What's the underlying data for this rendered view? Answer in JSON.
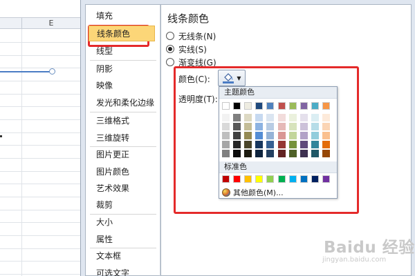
{
  "sheet": {
    "column_header": "E"
  },
  "nav": {
    "items": [
      {
        "label": "填充",
        "selected": false
      },
      {
        "label": "线条颜色",
        "selected": true
      },
      {
        "label": "线型",
        "selected": false
      },
      {
        "label": "阴影",
        "selected": false
      },
      {
        "label": "映像",
        "selected": false
      },
      {
        "label": "发光和柔化边缘",
        "selected": false
      },
      {
        "label": "三维格式",
        "selected": false
      },
      {
        "label": "三维旋转",
        "selected": false
      },
      {
        "label": "图片更正",
        "selected": false
      },
      {
        "label": "图片颜色",
        "selected": false
      },
      {
        "label": "艺术效果",
        "selected": false
      },
      {
        "label": "裁剪",
        "selected": false
      },
      {
        "label": "大小",
        "selected": false
      },
      {
        "label": "属性",
        "selected": false
      },
      {
        "label": "文本框",
        "selected": false
      },
      {
        "label": "可选文字",
        "selected": false
      }
    ]
  },
  "panel": {
    "title": "线条颜色",
    "options": [
      {
        "label": "无线条(N)",
        "checked": false
      },
      {
        "label": "实线(S)",
        "checked": true
      },
      {
        "label": "渐变线(G)",
        "checked": false
      }
    ],
    "color_label": "颜色(C):",
    "transparency_label": "透明度(T):",
    "color_button_icon": "paint-bucket-icon"
  },
  "dropdown": {
    "theme_header": "主题颜色",
    "standard_header": "标准色",
    "more_colors": "其他颜色(M)...",
    "theme_colors": [
      {
        "base": "#ffffff",
        "shades": [
          "#f2f2f2",
          "#d9d9d9",
          "#bfbfbf",
          "#a6a6a6",
          "#808080"
        ]
      },
      {
        "base": "#000000",
        "shades": [
          "#7f7f7f",
          "#595959",
          "#404040",
          "#262626",
          "#0d0d0d"
        ]
      },
      {
        "base": "#eeece1",
        "shades": [
          "#ddd9c3",
          "#c4bd97",
          "#948a54",
          "#4a452a",
          "#1d1b10"
        ]
      },
      {
        "base": "#1f497d",
        "shades": [
          "#c6d9f0",
          "#8db3e2",
          "#548dd4",
          "#17365d",
          "#0f243e"
        ]
      },
      {
        "base": "#4f81bd",
        "shades": [
          "#dbe5f1",
          "#b8cce4",
          "#95b3d7",
          "#366092",
          "#244061"
        ]
      },
      {
        "base": "#c0504d",
        "shades": [
          "#f2dcdb",
          "#e5b9b7",
          "#d99694",
          "#953734",
          "#632423"
        ]
      },
      {
        "base": "#9bbb59",
        "shades": [
          "#ebf1dd",
          "#d7e3bc",
          "#c3d69b",
          "#76923c",
          "#4f6128"
        ]
      },
      {
        "base": "#8064a2",
        "shades": [
          "#e5e0ec",
          "#ccc1d9",
          "#b2a2c7",
          "#5f497a",
          "#3f3151"
        ]
      },
      {
        "base": "#4bacc6",
        "shades": [
          "#dbeef3",
          "#b7dde8",
          "#92cddc",
          "#31859b",
          "#205867"
        ]
      },
      {
        "base": "#f79646",
        "shades": [
          "#fdeada",
          "#fbd5b5",
          "#fac08f",
          "#e36c09",
          "#974806"
        ]
      }
    ],
    "standard_colors": [
      "#c00000",
      "#ff0000",
      "#ffc000",
      "#ffff00",
      "#92d050",
      "#00b050",
      "#00b0f0",
      "#0070c0",
      "#002060",
      "#7030a0"
    ]
  },
  "watermark": {
    "text": "Baidu 经验",
    "url": "jingyan.baidu.com"
  }
}
